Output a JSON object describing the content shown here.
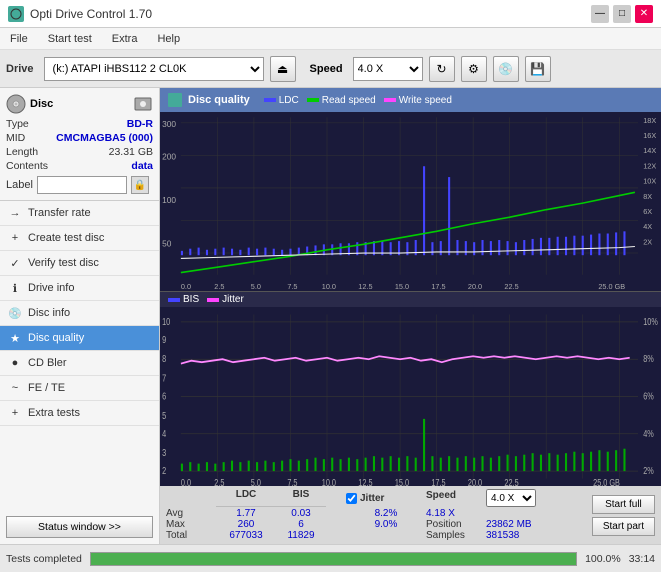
{
  "titlebar": {
    "title": "Opti Drive Control 1.70",
    "min_label": "—",
    "max_label": "□",
    "close_label": "✕"
  },
  "menubar": {
    "items": [
      "File",
      "Start test",
      "Extra",
      "Help"
    ]
  },
  "toolbar": {
    "drive_label": "Drive",
    "drive_value": "(k:) ATAPI iHBS112  2 CL0K",
    "speed_label": "Speed",
    "speed_value": "4.0 X"
  },
  "disc": {
    "header": "Disc",
    "type_label": "Type",
    "type_value": "BD-R",
    "mid_label": "MID",
    "mid_value": "CMCMAGBA5 (000)",
    "length_label": "Length",
    "length_value": "23.31 GB",
    "contents_label": "Contents",
    "contents_value": "data",
    "label_label": "Label"
  },
  "nav": {
    "items": [
      {
        "id": "transfer-rate",
        "label": "Transfer rate",
        "icon": "→"
      },
      {
        "id": "create-test-disc",
        "label": "Create test disc",
        "icon": "+"
      },
      {
        "id": "verify-test-disc",
        "label": "Verify test disc",
        "icon": "✓"
      },
      {
        "id": "drive-info",
        "label": "Drive info",
        "icon": "i"
      },
      {
        "id": "disc-info",
        "label": "Disc info",
        "icon": "📀"
      },
      {
        "id": "disc-quality",
        "label": "Disc quality",
        "icon": "★",
        "active": true
      },
      {
        "id": "cd-bler",
        "label": "CD Bler",
        "icon": "●"
      },
      {
        "id": "fe-te",
        "label": "FE / TE",
        "icon": "~"
      },
      {
        "id": "extra-tests",
        "label": "Extra tests",
        "icon": "+"
      }
    ],
    "status_btn": "Status window >>"
  },
  "content": {
    "title": "Disc quality",
    "legend": [
      {
        "label": "LDC",
        "color": "#0000ff"
      },
      {
        "label": "Read speed",
        "color": "#00aa00"
      },
      {
        "label": "Write speed",
        "color": "#ff00ff"
      }
    ],
    "legend2": [
      {
        "label": "BIS",
        "color": "#0000ff"
      },
      {
        "label": "Jitter",
        "color": "#ff00ff"
      }
    ]
  },
  "stats": {
    "columns": [
      "LDC",
      "BIS",
      "",
      "Jitter",
      "Speed",
      ""
    ],
    "avg_label": "Avg",
    "avg_ldc": "1.77",
    "avg_bis": "0.03",
    "avg_jitter": "8.2%",
    "avg_speed": "4.18 X",
    "avg_speed_sel": "4.0 X",
    "max_label": "Max",
    "max_ldc": "260",
    "max_bis": "6",
    "max_jitter": "9.0%",
    "max_position": "23862 MB",
    "total_label": "Total",
    "total_ldc": "677033",
    "total_bis": "11829",
    "total_samples": "381538",
    "position_label": "Position",
    "samples_label": "Samples",
    "jitter_label": "Jitter",
    "speed_label": "Speed",
    "start_full_label": "Start full",
    "start_part_label": "Start part"
  },
  "bottom": {
    "status_text": "Tests completed",
    "progress": "100.0%",
    "time": "33:14"
  }
}
